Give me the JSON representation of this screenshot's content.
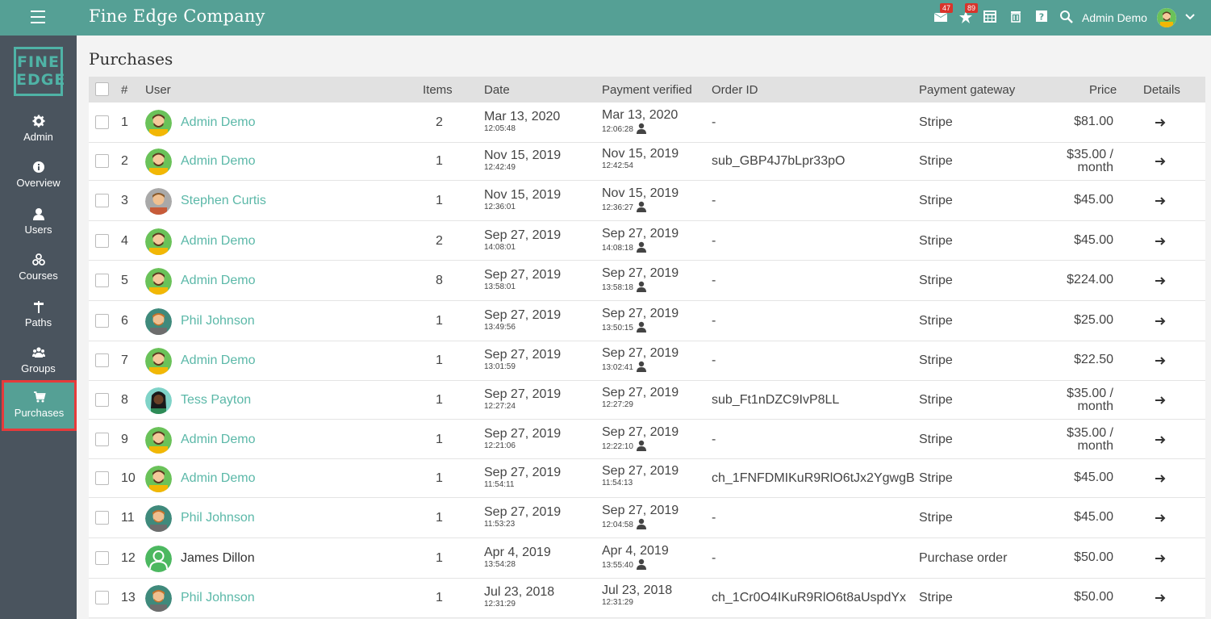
{
  "app": {
    "title": "Fine Edge Company"
  },
  "topbar": {
    "messages_badge": "47",
    "notifications_badge": "89",
    "user_name": "Admin Demo"
  },
  "sidebar": {
    "logo_line1": "FINE",
    "logo_line2": "EDGE",
    "items": [
      {
        "label": "Admin",
        "icon": "gear-icon"
      },
      {
        "label": "Overview",
        "icon": "info-icon"
      },
      {
        "label": "Users",
        "icon": "user-icon"
      },
      {
        "label": "Courses",
        "icon": "courses-icon"
      },
      {
        "label": "Paths",
        "icon": "signpost-icon"
      },
      {
        "label": "Groups",
        "icon": "group-icon"
      },
      {
        "label": "Purchases",
        "icon": "cart-icon",
        "active": true
      }
    ]
  },
  "page": {
    "title": "Purchases"
  },
  "table": {
    "columns": [
      "#",
      "User",
      "Items",
      "Date",
      "Payment verified",
      "Order ID",
      "Payment gateway",
      "Price",
      "Details"
    ],
    "rows": [
      {
        "n": "1",
        "user": "Admin Demo",
        "avatar": "green",
        "items": "2",
        "date": "Mar 13, 2020",
        "time": "12:05:48",
        "vdate": "Mar 13, 2020",
        "vtime": "12:06:28",
        "vicon": true,
        "order": "-",
        "gateway": "Stripe",
        "price1": "$81.00",
        "price2": ""
      },
      {
        "n": "2",
        "user": "Admin Demo",
        "avatar": "green",
        "items": "1",
        "date": "Nov 15, 2019",
        "time": "12:42:49",
        "vdate": "Nov 15, 2019",
        "vtime": "12:42:54",
        "vicon": false,
        "order": "sub_GBP4J7bLpr33pO",
        "gateway": "Stripe",
        "price1": "$35.00 /",
        "price2": "month"
      },
      {
        "n": "3",
        "user": "Stephen Curtis",
        "avatar": "gray",
        "items": "1",
        "date": "Nov 15, 2019",
        "time": "12:36:01",
        "vdate": "Nov 15, 2019",
        "vtime": "12:36:27",
        "vicon": true,
        "order": "-",
        "gateway": "Stripe",
        "price1": "$45.00",
        "price2": ""
      },
      {
        "n": "4",
        "user": "Admin Demo",
        "avatar": "green",
        "items": "2",
        "date": "Sep 27, 2019",
        "time": "14:08:01",
        "vdate": "Sep 27, 2019",
        "vtime": "14:08:18",
        "vicon": true,
        "order": "-",
        "gateway": "Stripe",
        "price1": "$45.00",
        "price2": ""
      },
      {
        "n": "5",
        "user": "Admin Demo",
        "avatar": "green",
        "items": "8",
        "date": "Sep 27, 2019",
        "time": "13:58:01",
        "vdate": "Sep 27, 2019",
        "vtime": "13:58:18",
        "vicon": true,
        "order": "-",
        "gateway": "Stripe",
        "price1": "$224.00",
        "price2": ""
      },
      {
        "n": "6",
        "user": "Phil Johnson",
        "avatar": "teal",
        "items": "1",
        "date": "Sep 27, 2019",
        "time": "13:49:56",
        "vdate": "Sep 27, 2019",
        "vtime": "13:50:15",
        "vicon": true,
        "order": "-",
        "gateway": "Stripe",
        "price1": "$25.00",
        "price2": ""
      },
      {
        "n": "7",
        "user": "Admin Demo",
        "avatar": "green",
        "items": "1",
        "date": "Sep 27, 2019",
        "time": "13:01:59",
        "vdate": "Sep 27, 2019",
        "vtime": "13:02:41",
        "vicon": true,
        "order": "-",
        "gateway": "Stripe",
        "price1": "$22.50",
        "price2": ""
      },
      {
        "n": "8",
        "user": "Tess Payton",
        "avatar": "mint",
        "items": "1",
        "date": "Sep 27, 2019",
        "time": "12:27:24",
        "vdate": "Sep 27, 2019",
        "vtime": "12:27:29",
        "vicon": false,
        "order": "sub_Ft1nDZC9IvP8LL",
        "gateway": "Stripe",
        "price1": "$35.00 /",
        "price2": "month"
      },
      {
        "n": "9",
        "user": "Admin Demo",
        "avatar": "green",
        "items": "1",
        "date": "Sep 27, 2019",
        "time": "12:21:06",
        "vdate": "Sep 27, 2019",
        "vtime": "12:22:10",
        "vicon": true,
        "order": "-",
        "gateway": "Stripe",
        "price1": "$35.00 /",
        "price2": "month"
      },
      {
        "n": "10",
        "user": "Admin Demo",
        "avatar": "green",
        "items": "1",
        "date": "Sep 27, 2019",
        "time": "11:54:11",
        "vdate": "Sep 27, 2019",
        "vtime": "11:54:13",
        "vicon": false,
        "order": "ch_1FNFDMIKuR9RlO6tJx2YgwgB",
        "gateway": "Stripe",
        "price1": "$45.00",
        "price2": ""
      },
      {
        "n": "11",
        "user": "Phil Johnson",
        "avatar": "teal",
        "items": "1",
        "date": "Sep 27, 2019",
        "time": "11:53:23",
        "vdate": "Sep 27, 2019",
        "vtime": "12:04:58",
        "vicon": true,
        "order": "-",
        "gateway": "Stripe",
        "price1": "$45.00",
        "price2": ""
      },
      {
        "n": "12",
        "user": "James Dillon",
        "avatar": "default",
        "items": "1",
        "date": "Apr 4, 2019",
        "time": "13:54:28",
        "vdate": "Apr 4, 2019",
        "vtime": "13:55:40",
        "vicon": true,
        "order": "-",
        "gateway": "Purchase order",
        "price1": "$50.00",
        "price2": "",
        "plain": true
      },
      {
        "n": "13",
        "user": "Phil Johnson",
        "avatar": "teal",
        "items": "1",
        "date": "Jul 23, 2018",
        "time": "12:31:29",
        "vdate": "Jul 23, 2018",
        "vtime": "12:31:29",
        "vicon": false,
        "order": "ch_1Cr0O4IKuR9RlO6t8aUspdYx",
        "gateway": "Stripe",
        "price1": "$50.00",
        "price2": ""
      }
    ]
  },
  "colors": {
    "topbar": "#55a095",
    "sidebar": "#4a545e",
    "link": "#5bb8a8",
    "highlight": "#e63b3b"
  }
}
